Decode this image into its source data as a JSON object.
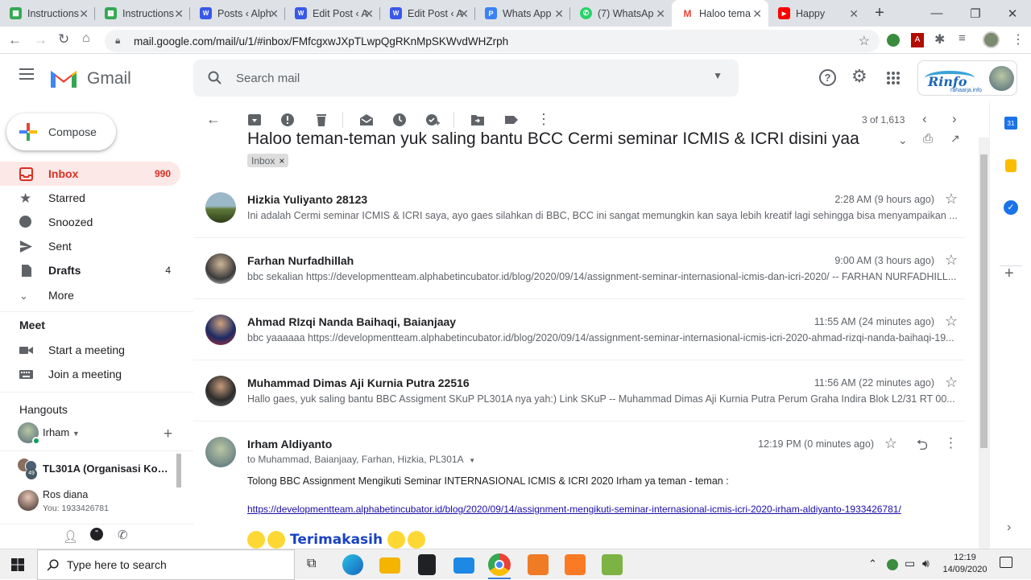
{
  "browser": {
    "tabs": [
      {
        "title": "Instructions",
        "icon": "sheets-icon",
        "color": "#34a853"
      },
      {
        "title": "Instructions",
        "icon": "sheets-icon",
        "color": "#34a853"
      },
      {
        "title": "Posts ‹ Alph",
        "icon": "wordpress-icon",
        "color": "#3858e9"
      },
      {
        "title": "Edit Post ‹ A",
        "icon": "wordpress-icon",
        "color": "#3858e9"
      },
      {
        "title": "Edit Post ‹ A",
        "icon": "wordpress-icon",
        "color": "#3858e9"
      },
      {
        "title": "Whats App",
        "icon": "p-icon",
        "color": "#3b82f6"
      },
      {
        "title": "(7) WhatsAp",
        "icon": "whatsapp-icon",
        "color": "#25d366"
      },
      {
        "title": "Haloo tema",
        "icon": "gmail-icon",
        "color": "#ea4335"
      },
      {
        "title": "Happy",
        "icon": "youtube-icon",
        "color": "#ff0000"
      }
    ],
    "url": "mail.google.com/mail/u/1/#inbox/FMfcgxwJXpTLwpQgRKnMpSKWvdWHZrph"
  },
  "gmail": {
    "brand": "Gmail",
    "search_placeholder": "Search mail",
    "account_logo_text": "Rinfo",
    "account_logo_sub": "rahaarja.info"
  },
  "sidebar": {
    "compose": "Compose",
    "items": [
      {
        "label": "Inbox",
        "count": "990"
      },
      {
        "label": "Starred",
        "count": ""
      },
      {
        "label": "Snoozed",
        "count": ""
      },
      {
        "label": "Sent",
        "count": ""
      },
      {
        "label": "Drafts",
        "count": "4"
      },
      {
        "label": "More",
        "count": ""
      }
    ],
    "meet": {
      "heading": "Meet",
      "start": "Start a meeting",
      "join": "Join a meeting"
    },
    "hangouts": {
      "heading": "Hangouts",
      "me": "Irham",
      "contacts": [
        {
          "name": "TL301A (Organisasi Komput",
          "status": ""
        },
        {
          "name": "Ros diana",
          "status": "You: 1933426781"
        }
      ]
    }
  },
  "toolbar": {
    "pager": "3 of 1,613"
  },
  "thread": {
    "subject": "Haloo teman-teman yuk saling bantu BCC Cermi seminar ICMIS & ICRI disini yaa",
    "label": "Inbox",
    "messages": [
      {
        "sender": "Hizkia Yuliyanto 28123",
        "time": "2:28 AM (9 hours ago)",
        "snippet": "Ini adalah Cermi seminar ICMIS & ICRI saya, ayo gaes silahkan di BBC, BCC ini sangat memungkin kan saya lebih kreatif lagi sehingga bisa menyampaikan ..."
      },
      {
        "sender": "Farhan Nurfadhillah",
        "time": "9:00 AM (3 hours ago)",
        "snippet": "bbc sekalian https://developmentteam.alphabetincubator.id/blog/2020/09/14/assignment-seminar-internasional-icmis-dan-icri-2020/ -- FARHAN NURFADHILL..."
      },
      {
        "sender": "Ahmad RIzqi Nanda Baihaqi, Baianjaay",
        "time": "11:55 AM (24 minutes ago)",
        "snippet": "bbc yaaaaaa https://developmentteam.alphabetincubator.id/blog/2020/09/14/assignment-seminar-internasional-icmis-icri-2020-ahmad-rizqi-nanda-baihaqi-19..."
      },
      {
        "sender": "Muhammad Dimas Aji Kurnia Putra 22516",
        "time": "11:56 AM (22 minutes ago)",
        "snippet": "Hallo gaes, yuk saling bantu BBC Assigment SKuP PL301A nya yah:) Link SKuP -- Muhammad Dimas Aji Kurnia Putra Perum Graha Indira Blok L2/31 RT 00..."
      }
    ],
    "open": {
      "sender": "Irham Aldiyanto",
      "time": "12:19 PM (0 minutes ago)",
      "to": "to Muhammad, Baianjaay, Farhan, Hizkia, PL301A",
      "body": "Tolong BBC Assignment Mengikuti Seminar INTERNASIONAL ICMIS & ICRI 2020 Irham ya teman - teman :",
      "link": "https://developmentteam.alphabetincubator.id/blog/2020/09/14/assignment-mengikuti-seminar-internasional-icmis-icri-2020-irham-aldiyanto-1933426781/",
      "thanks": "Terimakasih"
    }
  },
  "taskbar": {
    "search_placeholder": "Type here to search",
    "time": "12:19",
    "date": "14/09/2020"
  },
  "colors": {
    "accent_red": "#d93025",
    "link": "#1a0dab",
    "inbox_bg": "#fce8e6"
  }
}
